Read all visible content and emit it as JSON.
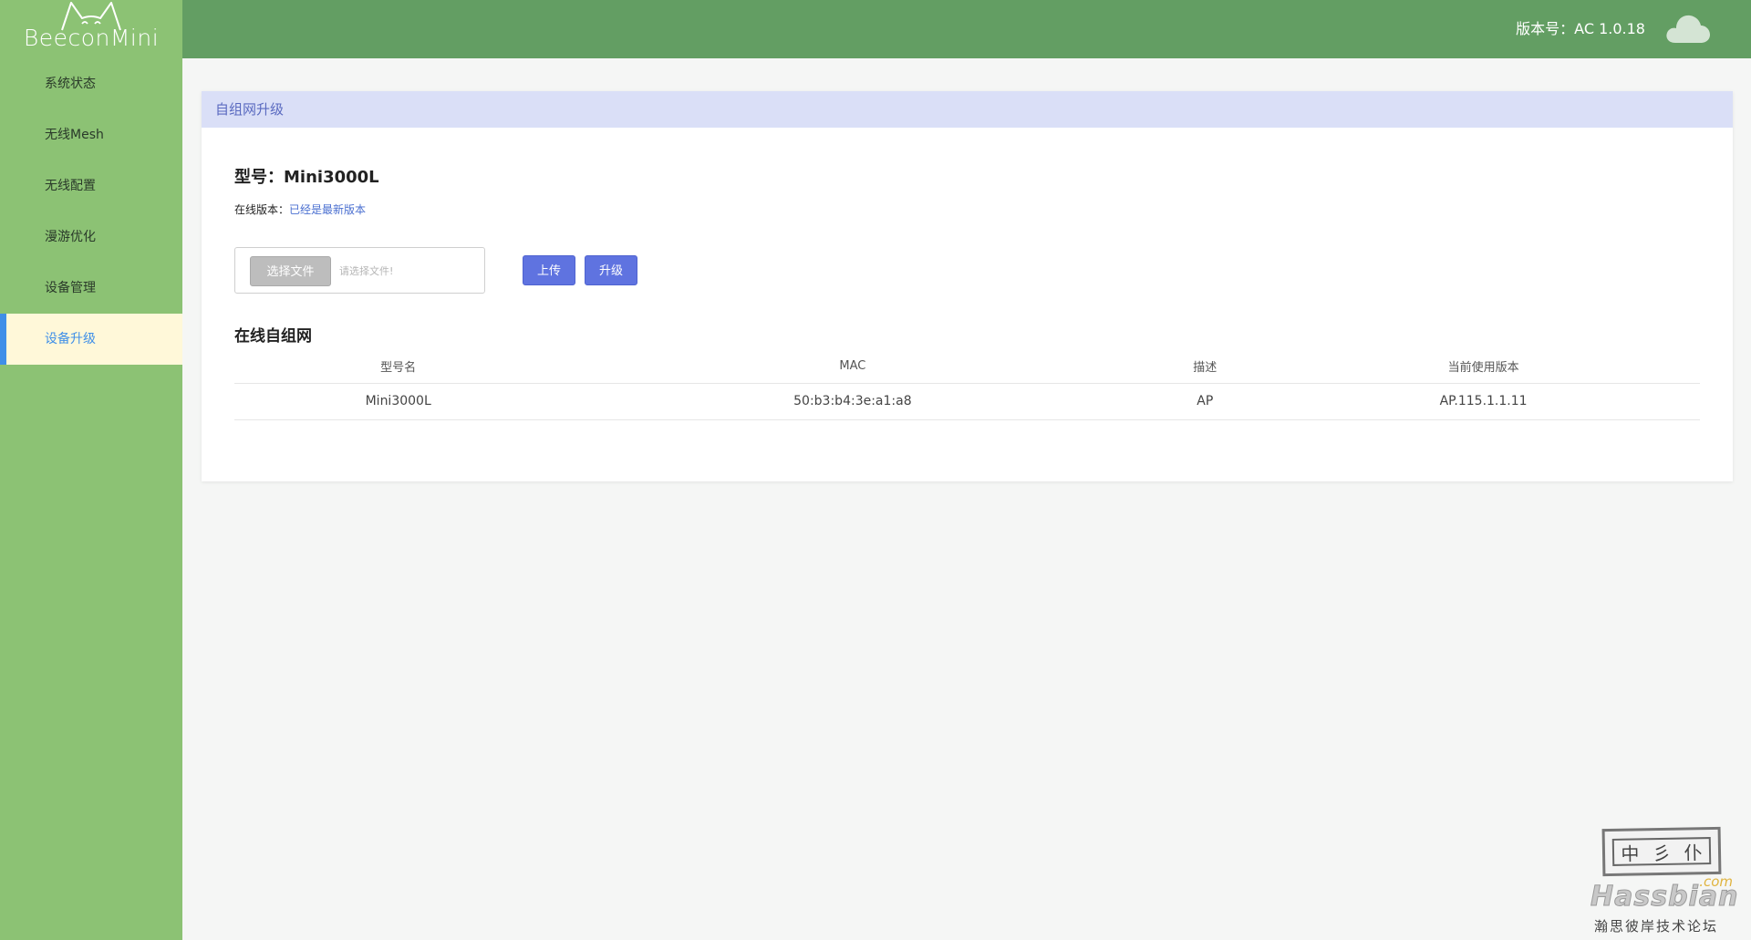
{
  "app": {
    "logo_text": "BeeconMini",
    "logo_icon": "cat-ears-icon"
  },
  "sidebar": {
    "items": [
      {
        "label": "系统状态",
        "active": false
      },
      {
        "label": "无线Mesh",
        "active": false
      },
      {
        "label": "无线配置",
        "active": false
      },
      {
        "label": "漫游优化",
        "active": false
      },
      {
        "label": "设备管理",
        "active": false
      },
      {
        "label": "设备升级",
        "active": true
      }
    ]
  },
  "header": {
    "version_text": "版本号：AC 1.0.18",
    "cloud_icon": "cloud-icon"
  },
  "panel": {
    "title": "自组网升级",
    "model_title": "型号：Mini3000L",
    "online_version_label": "在线版本：",
    "online_version_value": "已经是最新版本",
    "choose_file_label": "选择文件",
    "file_placeholder": "请选择文件!",
    "upload_label": "上传",
    "upgrade_label": "升级",
    "section_title": "在线自组网",
    "table": {
      "headers": [
        "型号名",
        "MAC",
        "描述",
        "当前使用版本"
      ],
      "rows": [
        [
          "Mini3000L",
          "50:b3:b4:3e:a1:a8",
          "AP",
          "AP.115.1.1.11"
        ]
      ]
    }
  },
  "watermark": {
    "seal_chars": [
      "中",
      "彡",
      "仆"
    ],
    "com": ".com",
    "brand": "Hassbian",
    "subtitle": "瀚思彼岸技术论坛"
  },
  "colors": {
    "sidebar_bg": "#8cc274",
    "topbar_bg": "#639e63",
    "active_item_bg": "#fff8d9",
    "active_item_text": "#3f8fe8",
    "panel_header_bg": "#dadff7",
    "primary_button": "#5f73e0"
  }
}
